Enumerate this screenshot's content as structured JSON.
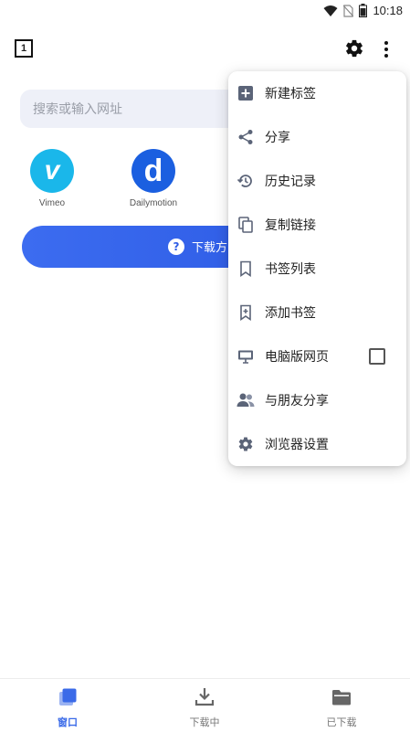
{
  "status_bar": {
    "time": "10:18"
  },
  "toolbar": {
    "tab_count": "1"
  },
  "search": {
    "placeholder": "搜索或输入网址"
  },
  "shortcuts": [
    {
      "label": "Vimeo",
      "logo_text": "v",
      "color": "#1ab7ea"
    },
    {
      "label": "Dailymotion",
      "logo_text": "d",
      "color": "#1b5fe0"
    }
  ],
  "download_banner": {
    "text": "下载方",
    "help_symbol": "?"
  },
  "menu": {
    "items": [
      {
        "label": "新建标签",
        "icon": "add-box-icon"
      },
      {
        "label": "分享",
        "icon": "share-icon"
      },
      {
        "label": "历史记录",
        "icon": "history-icon"
      },
      {
        "label": "复制链接",
        "icon": "copy-icon"
      },
      {
        "label": "书签列表",
        "icon": "bookmark-icon"
      },
      {
        "label": "添加书签",
        "icon": "bookmark-add-icon"
      },
      {
        "label": "电脑版网页",
        "icon": "monitor-icon",
        "checked": false
      },
      {
        "label": "与朋友分享",
        "icon": "people-icon"
      },
      {
        "label": "浏览器设置",
        "icon": "gear-icon"
      }
    ]
  },
  "bottom_nav": {
    "items": [
      {
        "label": "窗口",
        "icon": "windows-icon",
        "active": true
      },
      {
        "label": "下载中",
        "icon": "download-icon",
        "active": false
      },
      {
        "label": "已下载",
        "icon": "folder-icon",
        "active": false
      }
    ]
  },
  "colors": {
    "accent": "#3a6ae8",
    "menu_icon": "#5b6478",
    "banner": "#2f5de6"
  }
}
